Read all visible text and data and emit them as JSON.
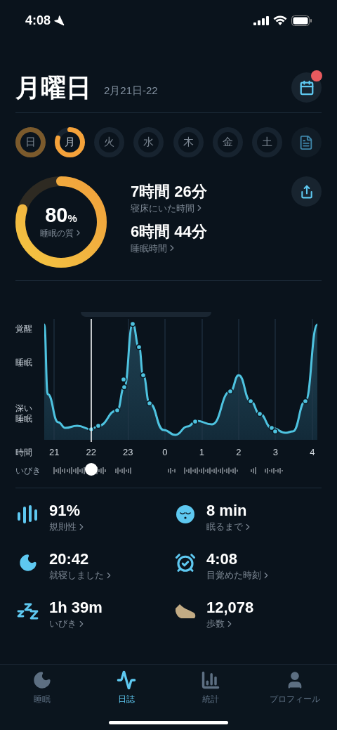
{
  "status_bar": {
    "time": "4:08"
  },
  "header": {
    "title": "月曜日",
    "date": "2月21日-22",
    "calendar_badge": true
  },
  "days": [
    {
      "label": "日",
      "selected": false,
      "recorded": true
    },
    {
      "label": "月",
      "selected": true,
      "recorded": true
    },
    {
      "label": "火",
      "selected": false,
      "recorded": false
    },
    {
      "label": "水",
      "selected": false,
      "recorded": false
    },
    {
      "label": "木",
      "selected": false,
      "recorded": false
    },
    {
      "label": "金",
      "selected": false,
      "recorded": false
    },
    {
      "label": "土",
      "selected": false,
      "recorded": false
    }
  ],
  "summary": {
    "quality": {
      "value": "80",
      "unit": "%",
      "label": "睡眠の質"
    },
    "metrics": [
      {
        "value": "7時間 26分",
        "label": "寝床にいた時間"
      },
      {
        "value": "6時間 44分",
        "label": "睡眠時間"
      }
    ]
  },
  "chart": {
    "y_labels": [
      "覚醒",
      "睡眠",
      "深い睡眠"
    ],
    "x_title": "時間",
    "x_labels": [
      "21",
      "22",
      "23",
      "0",
      "1",
      "2",
      "3",
      "4"
    ],
    "snore_label": "いびき"
  },
  "stats": [
    {
      "kind": "regularity",
      "value": "91%",
      "label": "規則性"
    },
    {
      "kind": "latency",
      "value": "8 min",
      "label": "眠るまで"
    },
    {
      "kind": "bedtime",
      "value": "20:42",
      "label": "就寝しました"
    },
    {
      "kind": "wake",
      "value": "4:08",
      "label": "目覚めた時刻"
    },
    {
      "kind": "snore",
      "value": "1h 39m",
      "label": "いびき"
    },
    {
      "kind": "steps",
      "value": "12,078",
      "label": "歩数"
    }
  ],
  "tabs": [
    {
      "kind": "sleep",
      "label": "睡眠",
      "selected": false
    },
    {
      "kind": "journal",
      "label": "日誌",
      "selected": true
    },
    {
      "kind": "stats",
      "label": "統計",
      "selected": false
    },
    {
      "kind": "profile",
      "label": "プロフィール",
      "selected": false
    }
  ]
}
